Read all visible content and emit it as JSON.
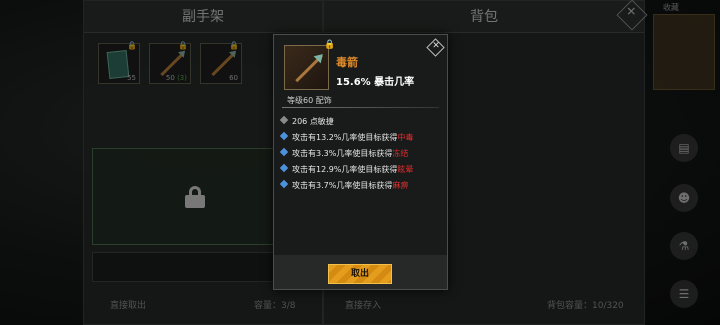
{
  "tabs": {
    "left": "副手架",
    "right": "背包"
  },
  "slots": [
    {
      "count": "55",
      "sub": ""
    },
    {
      "count": "50",
      "sub": "(3)"
    },
    {
      "count": "60",
      "sub": ""
    }
  ],
  "footer": {
    "take_out": "直接取出",
    "capacity": "容量：3/8",
    "store": "直接存入",
    "bag_capacity": "背包容量：10/320"
  },
  "side": {
    "label": "收藏"
  },
  "item": {
    "name": "毒箭",
    "stat": "15.6% 暴击几率",
    "level": "等级60 配饰",
    "base_attr": "206 点敏捷",
    "effects": [
      {
        "text": "攻击有13.2%几率使目标获得",
        "status": "中毒"
      },
      {
        "text": "攻击有3.3%几率使目标获得",
        "status": "冻结"
      },
      {
        "text": "攻击有12.9%几率使目标获得",
        "status": "眩晕"
      },
      {
        "text": "攻击有3.7%几率使目标获得",
        "status": "麻痹"
      }
    ],
    "take_button": "取出"
  },
  "colors": {
    "accent": "#e59d1d",
    "item_name": "#e08a2a",
    "status": "#e02c2c"
  }
}
